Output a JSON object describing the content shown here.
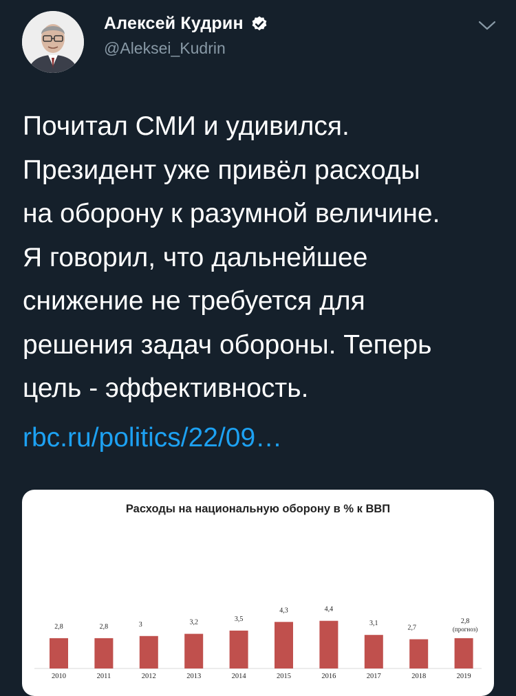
{
  "tweet": {
    "display_name": "Алексей Кудрин",
    "handle": "@Aleksei_Kudrin",
    "text": "Почитал СМИ и удивился.\nПрезидент уже привёл расходы\nна оборону к разумной величине.\nЯ говорил, что дальнейшее\nснижение не требуется для\nрешения задач обороны. Теперь\nцель - эффективность.",
    "link": "rbc.ru/politics/22/09…"
  },
  "icons": {
    "verified": "verified-badge-icon",
    "caret": "chevron-down-icon"
  },
  "colors": {
    "background": "#15202b",
    "link": "#1da1f2",
    "secondary_text": "#8899a6",
    "bar": "#c0504d"
  },
  "chart_data": {
    "type": "bar",
    "title": "Расходы на национальную оборону в % к ВВП",
    "categories": [
      "2010",
      "2011",
      "2012",
      "2013",
      "2014",
      "2015",
      "2016",
      "2017",
      "2018",
      "2019"
    ],
    "values": [
      2.8,
      2.8,
      3.0,
      3.2,
      3.5,
      4.3,
      4.4,
      3.1,
      2.7,
      2.8
    ],
    "value_labels": [
      "2,8",
      "2,8",
      "3",
      "3,2",
      "3,5",
      "4,3",
      "4,4",
      "3,1",
      "2,7",
      "2,8"
    ],
    "annotations": [
      {
        "category": "2019",
        "text": "(прогноз)"
      }
    ],
    "ylim": [
      0,
      5
    ],
    "grid": false,
    "legend": "none"
  }
}
